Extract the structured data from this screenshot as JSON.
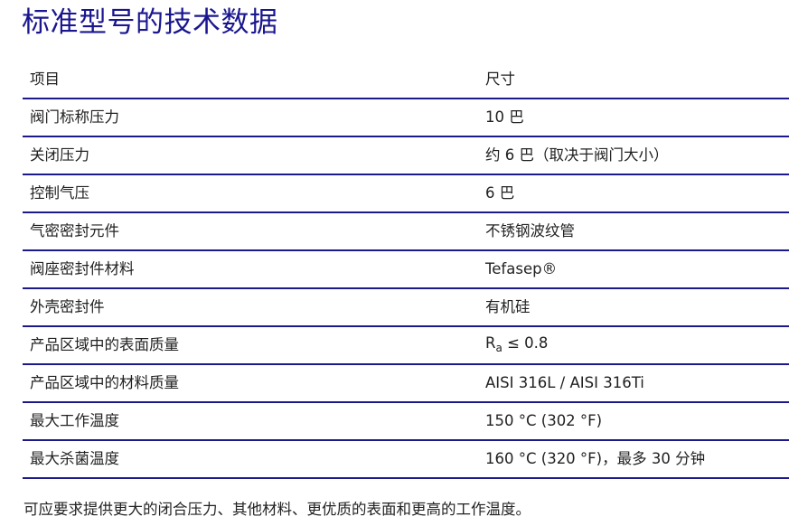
{
  "title": "标准型号的技术数据",
  "table": {
    "header": {
      "item": "项目",
      "value": "尺寸"
    },
    "rows": [
      {
        "item": "阀门标称压力",
        "value": "10 巴"
      },
      {
        "item": "关闭压力",
        "value": "约 6 巴（取决于阀门大小）"
      },
      {
        "item": "控制气压",
        "value": "6 巴"
      },
      {
        "item": "气密密封元件",
        "value": "不锈钢波纹管"
      },
      {
        "item": "阀座密封件材料",
        "value": "Tefasep®"
      },
      {
        "item": "外壳密封件",
        "value": "有机硅"
      },
      {
        "item": "产品区域中的表面质量",
        "value_symbol": "R",
        "value_sub": "a",
        "value_rest": " ≤ 0.8"
      },
      {
        "item": "产品区域中的材料质量",
        "value": "AISI 316L / AISI 316Ti"
      },
      {
        "item": "最大工作温度",
        "value": "150 °C (302 °F)"
      },
      {
        "item": "最大杀菌温度",
        "value": "160 °C (320 °F)，最多 30 分钟"
      }
    ]
  },
  "footnote": "可应要求提供更大的闭合压力、其他材料、更优质的表面和更高的工作温度。",
  "colors": {
    "title": "#1a168f",
    "rule": "#1c1a8a",
    "text": "#222222"
  }
}
